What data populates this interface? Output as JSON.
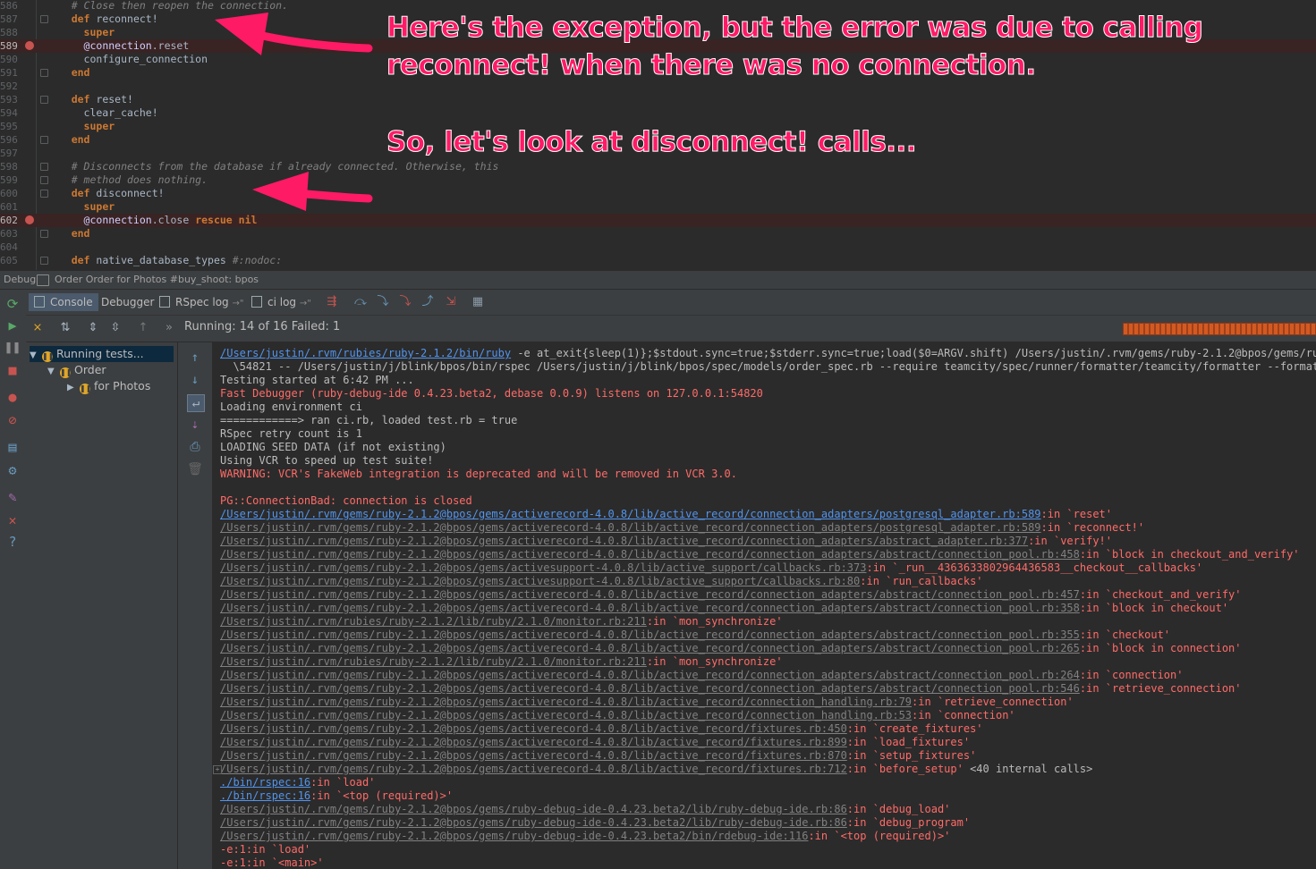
{
  "editor": {
    "lines": [
      {
        "num": "586",
        "code": [
          {
            "t": "    # Close then reopen the connection.",
            "c": "cm"
          }
        ]
      },
      {
        "num": "587",
        "code": [
          {
            "t": "    "
          },
          {
            "t": "def",
            "c": "kw"
          },
          {
            "t": " reconnect!"
          }
        ]
      },
      {
        "num": "588",
        "code": [
          {
            "t": "      "
          },
          {
            "t": "super",
            "c": "kw"
          }
        ]
      },
      {
        "num": "589",
        "bp": true,
        "code": [
          {
            "t": "      "
          },
          {
            "t": "@connection",
            "c": "iv"
          },
          {
            "t": ".reset"
          }
        ]
      },
      {
        "num": "590",
        "code": [
          {
            "t": "      configure_connection"
          }
        ]
      },
      {
        "num": "591",
        "code": [
          {
            "t": "    "
          },
          {
            "t": "end",
            "c": "kw"
          }
        ]
      },
      {
        "num": "592",
        "code": []
      },
      {
        "num": "593",
        "code": [
          {
            "t": "    "
          },
          {
            "t": "def",
            "c": "kw"
          },
          {
            "t": " reset!"
          }
        ]
      },
      {
        "num": "594",
        "code": [
          {
            "t": "      clear_cache!"
          }
        ]
      },
      {
        "num": "595",
        "code": [
          {
            "t": "      "
          },
          {
            "t": "super",
            "c": "kw"
          }
        ]
      },
      {
        "num": "596",
        "code": [
          {
            "t": "    "
          },
          {
            "t": "end",
            "c": "kw"
          }
        ]
      },
      {
        "num": "597",
        "code": []
      },
      {
        "num": "598",
        "code": [
          {
            "t": "    # Disconnects from the database if already connected. Otherwise, this",
            "c": "cm"
          }
        ]
      },
      {
        "num": "599",
        "code": [
          {
            "t": "    # method does nothing.",
            "c": "cm"
          }
        ]
      },
      {
        "num": "600",
        "code": [
          {
            "t": "    "
          },
          {
            "t": "def",
            "c": "kw"
          },
          {
            "t": " disconnect!"
          }
        ]
      },
      {
        "num": "601",
        "code": [
          {
            "t": "      "
          },
          {
            "t": "super",
            "c": "kw"
          }
        ]
      },
      {
        "num": "602",
        "bp": true,
        "code": [
          {
            "t": "      "
          },
          {
            "t": "@connection",
            "c": "iv"
          },
          {
            "t": ".close "
          },
          {
            "t": "rescue",
            "c": "kw"
          },
          {
            "t": " "
          },
          {
            "t": "nil",
            "c": "kw"
          }
        ]
      },
      {
        "num": "603",
        "code": [
          {
            "t": "    "
          },
          {
            "t": "end",
            "c": "kw"
          }
        ]
      },
      {
        "num": "604",
        "code": []
      },
      {
        "num": "605",
        "code": [
          {
            "t": "    "
          },
          {
            "t": "def",
            "c": "kw"
          },
          {
            "t": " native_database_types "
          },
          {
            "t": "#:nodoc:",
            "c": "cm"
          }
        ]
      }
    ]
  },
  "annotations": {
    "line1": "Here's the exception, but the error was due to calling",
    "line2": "reconnect! when there was no connection.",
    "line3": "So, let's look at disconnect! calls..."
  },
  "debug_bar": {
    "label": "Debug",
    "config": "Order Order for Photos #buy_shoot: bpos"
  },
  "tabs": {
    "console": "Console",
    "debugger": "Debugger",
    "rspec_log": "RSpec log",
    "ci_log": "ci log"
  },
  "test_status": "Running: 14 of 16  Failed: 1",
  "tree": {
    "root": "Running tests...",
    "child": "Order",
    "grandchild": "for Photos"
  },
  "console": [
    {
      "c": "norm",
      "parts": [
        {
          "t": "/Users/justin/.rvm/rubies/ruby-2.1.2/bin/ruby",
          "l": "lnk"
        },
        {
          "t": " -e at_exit{sleep(1)};$stdout.sync=true;$stderr.sync=true;load($0=ARGV.shift) /Users/justin/.rvm/gems/ruby-2.1.2@bpos/gems/ruby-de"
        }
      ]
    },
    {
      "c": "norm",
      "parts": [
        {
          "t": "  \\54821 -- /Users/justin/j/blink/bpos/bin/rspec /Users/justin/j/blink/bpos/spec/models/order_spec.rb --require teamcity/spec/runner/formatter/teamcity/formatter --format Spec"
        }
      ]
    },
    {
      "c": "norm",
      "parts": [
        {
          "t": "Testing started at 6:42 PM ..."
        }
      ]
    },
    {
      "c": "red",
      "parts": [
        {
          "t": "Fast Debugger (ruby-debug-ide 0.4.23.beta2, debase 0.0.9) listens on 127.0.0.1:54820"
        }
      ]
    },
    {
      "c": "norm",
      "parts": [
        {
          "t": "Loading environment ci"
        }
      ]
    },
    {
      "c": "norm",
      "parts": [
        {
          "t": "============> ran ci.rb, loaded test.rb = true"
        }
      ]
    },
    {
      "c": "norm",
      "parts": [
        {
          "t": "RSpec retry count is 1"
        }
      ]
    },
    {
      "c": "norm",
      "parts": [
        {
          "t": "LOADING SEED DATA (if not existing)"
        }
      ]
    },
    {
      "c": "norm",
      "parts": [
        {
          "t": "Using VCR to speed up test suite!"
        }
      ]
    },
    {
      "c": "red",
      "parts": [
        {
          "t": "WARNING: VCR's FakeWeb integration is deprecated and will be removed in VCR 3.0."
        }
      ]
    },
    {
      "c": "red",
      "parts": [
        {
          "t": ""
        }
      ]
    },
    {
      "c": "red",
      "parts": [
        {
          "t": "PG::ConnectionBad: connection is closed"
        }
      ]
    },
    {
      "c": "red",
      "parts": [
        {
          "t": "/Users/justin/.rvm/gems/ruby-2.1.2@bpos/gems/activerecord-4.0.8/lib/active_record/connection_adapters/postgresql_adapter.rb:589",
          "l": "lnk"
        },
        {
          "t": ":in `reset'"
        }
      ]
    },
    {
      "c": "red",
      "parts": [
        {
          "t": "/Users/justin/.rvm/gems/ruby-2.1.2@bpos/gems/activerecord-4.0.8/lib/active_record/connection_adapters/postgresql_adapter.rb:589",
          "l": "lnkg"
        },
        {
          "t": ":in `reconnect!'"
        }
      ]
    },
    {
      "c": "red",
      "parts": [
        {
          "t": "/Users/justin/.rvm/gems/ruby-2.1.2@bpos/gems/activerecord-4.0.8/lib/active_record/connection_adapters/abstract_adapter.rb:377",
          "l": "lnkg"
        },
        {
          "t": ":in `verify!'"
        }
      ]
    },
    {
      "c": "red",
      "parts": [
        {
          "t": "/Users/justin/.rvm/gems/ruby-2.1.2@bpos/gems/activerecord-4.0.8/lib/active_record/connection_adapters/abstract/connection_pool.rb:458",
          "l": "lnkg"
        },
        {
          "t": ":in `block in checkout_and_verify'"
        }
      ]
    },
    {
      "c": "red",
      "parts": [
        {
          "t": "/Users/justin/.rvm/gems/ruby-2.1.2@bpos/gems/activesupport-4.0.8/lib/active_support/callbacks.rb:373",
          "l": "lnkg"
        },
        {
          "t": ":in `_run__4363633802964436583__checkout__callbacks'"
        }
      ]
    },
    {
      "c": "red",
      "parts": [
        {
          "t": "/Users/justin/.rvm/gems/ruby-2.1.2@bpos/gems/activesupport-4.0.8/lib/active_support/callbacks.rb:80",
          "l": "lnkg"
        },
        {
          "t": ":in `run_callbacks'"
        }
      ]
    },
    {
      "c": "red",
      "parts": [
        {
          "t": "/Users/justin/.rvm/gems/ruby-2.1.2@bpos/gems/activerecord-4.0.8/lib/active_record/connection_adapters/abstract/connection_pool.rb:457",
          "l": "lnkg"
        },
        {
          "t": ":in `checkout_and_verify'"
        }
      ]
    },
    {
      "c": "red",
      "parts": [
        {
          "t": "/Users/justin/.rvm/gems/ruby-2.1.2@bpos/gems/activerecord-4.0.8/lib/active_record/connection_adapters/abstract/connection_pool.rb:358",
          "l": "lnkg"
        },
        {
          "t": ":in `block in checkout'"
        }
      ]
    },
    {
      "c": "red",
      "parts": [
        {
          "t": "/Users/justin/.rvm/rubies/ruby-2.1.2/lib/ruby/2.1.0/monitor.rb:211",
          "l": "lnkg"
        },
        {
          "t": ":in `mon_synchronize'"
        }
      ]
    },
    {
      "c": "red",
      "parts": [
        {
          "t": "/Users/justin/.rvm/gems/ruby-2.1.2@bpos/gems/activerecord-4.0.8/lib/active_record/connection_adapters/abstract/connection_pool.rb:355",
          "l": "lnkg"
        },
        {
          "t": ":in `checkout'"
        }
      ]
    },
    {
      "c": "red",
      "parts": [
        {
          "t": "/Users/justin/.rvm/gems/ruby-2.1.2@bpos/gems/activerecord-4.0.8/lib/active_record/connection_adapters/abstract/connection_pool.rb:265",
          "l": "lnkg"
        },
        {
          "t": ":in `block in connection'"
        }
      ]
    },
    {
      "c": "red",
      "parts": [
        {
          "t": "/Users/justin/.rvm/rubies/ruby-2.1.2/lib/ruby/2.1.0/monitor.rb:211",
          "l": "lnkg"
        },
        {
          "t": ":in `mon_synchronize'"
        }
      ]
    },
    {
      "c": "red",
      "parts": [
        {
          "t": "/Users/justin/.rvm/gems/ruby-2.1.2@bpos/gems/activerecord-4.0.8/lib/active_record/connection_adapters/abstract/connection_pool.rb:264",
          "l": "lnkg"
        },
        {
          "t": ":in `connection'"
        }
      ]
    },
    {
      "c": "red",
      "parts": [
        {
          "t": "/Users/justin/.rvm/gems/ruby-2.1.2@bpos/gems/activerecord-4.0.8/lib/active_record/connection_adapters/abstract/connection_pool.rb:546",
          "l": "lnkg"
        },
        {
          "t": ":in `retrieve_connection'"
        }
      ]
    },
    {
      "c": "red",
      "parts": [
        {
          "t": "/Users/justin/.rvm/gems/ruby-2.1.2@bpos/gems/activerecord-4.0.8/lib/active_record/connection_handling.rb:79",
          "l": "lnkg"
        },
        {
          "t": ":in `retrieve_connection'"
        }
      ]
    },
    {
      "c": "red",
      "parts": [
        {
          "t": "/Users/justin/.rvm/gems/ruby-2.1.2@bpos/gems/activerecord-4.0.8/lib/active_record/connection_handling.rb:53",
          "l": "lnkg"
        },
        {
          "t": ":in `connection'"
        }
      ]
    },
    {
      "c": "red",
      "parts": [
        {
          "t": "/Users/justin/.rvm/gems/ruby-2.1.2@bpos/gems/activerecord-4.0.8/lib/active_record/fixtures.rb:450",
          "l": "lnkg"
        },
        {
          "t": ":in `create_fixtures'"
        }
      ]
    },
    {
      "c": "red",
      "parts": [
        {
          "t": "/Users/justin/.rvm/gems/ruby-2.1.2@bpos/gems/activerecord-4.0.8/lib/active_record/fixtures.rb:899",
          "l": "lnkg"
        },
        {
          "t": ":in `load_fixtures'"
        }
      ]
    },
    {
      "c": "red",
      "parts": [
        {
          "t": "/Users/justin/.rvm/gems/ruby-2.1.2@bpos/gems/activerecord-4.0.8/lib/active_record/fixtures.rb:870",
          "l": "lnkg"
        },
        {
          "t": ":in `setup_fixtures'"
        }
      ]
    },
    {
      "c": "red",
      "fold": true,
      "parts": [
        {
          "t": "/Users/justin/.rvm/gems/ruby-2.1.2@bpos/gems/activerecord-4.0.8/lib/active_record/fixtures.rb:712",
          "l": "lnkg"
        },
        {
          "t": ":in `before_setup' "
        },
        {
          "t": "<40 internal calls>",
          "l": "int"
        }
      ]
    },
    {
      "c": "red",
      "parts": [
        {
          "t": "./bin/rspec:16",
          "l": "lnk"
        },
        {
          "t": ":in `load'"
        }
      ]
    },
    {
      "c": "red",
      "parts": [
        {
          "t": "./bin/rspec:16",
          "l": "lnk"
        },
        {
          "t": ":in `<top (required)>'"
        }
      ]
    },
    {
      "c": "red",
      "parts": [
        {
          "t": "/Users/justin/.rvm/gems/ruby-2.1.2@bpos/gems/ruby-debug-ide-0.4.23.beta2/lib/ruby-debug-ide.rb:86",
          "l": "lnkg"
        },
        {
          "t": ":in `debug_load'"
        }
      ]
    },
    {
      "c": "red",
      "parts": [
        {
          "t": "/Users/justin/.rvm/gems/ruby-2.1.2@bpos/gems/ruby-debug-ide-0.4.23.beta2/lib/ruby-debug-ide.rb:86",
          "l": "lnkg"
        },
        {
          "t": ":in `debug_program'"
        }
      ]
    },
    {
      "c": "red",
      "parts": [
        {
          "t": "/Users/justin/.rvm/gems/ruby-2.1.2@bpos/gems/ruby-debug-ide-0.4.23.beta2/bin/rdebug-ide:116",
          "l": "lnkg"
        },
        {
          "t": ":in `<top (required)>'"
        }
      ]
    },
    {
      "c": "red",
      "parts": [
        {
          "t": "-e:1:in `load'"
        }
      ]
    },
    {
      "c": "red",
      "parts": [
        {
          "t": "-e:1:in `<main>'"
        }
      ]
    }
  ]
}
